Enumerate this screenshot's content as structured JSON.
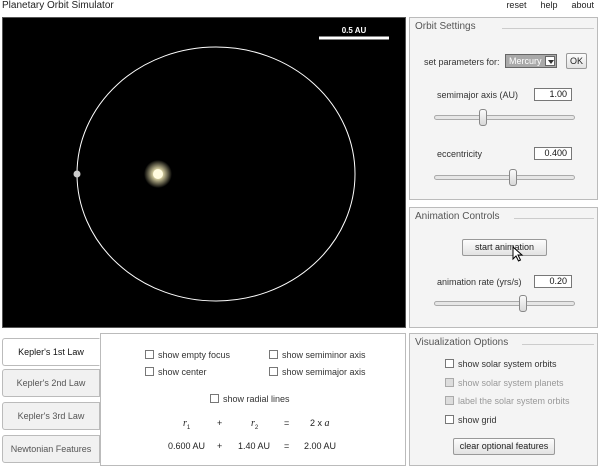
{
  "app": {
    "title": "Planetary Orbit Simulator"
  },
  "top_links": [
    "reset",
    "help",
    "about"
  ],
  "sim": {
    "scale_label": "0.5 AU"
  },
  "orbit_settings": {
    "title": "Orbit Settings",
    "set_params_label": "set parameters for:",
    "planet_selected": "Mercury",
    "ok_label": "OK",
    "semimajor_label": "semimajor axis (AU)",
    "semimajor_value": "1.00",
    "semimajor_slider": 0.35,
    "eccentricity_label": "eccentricity",
    "eccentricity_value": "0.400",
    "eccentricity_slider": 0.56
  },
  "animation": {
    "title": "Animation Controls",
    "start_label": "start animation",
    "rate_label": "animation rate (yrs/s)",
    "rate_value": "0.20",
    "rate_slider": 0.63
  },
  "visualization": {
    "title": "Visualization Options",
    "options": [
      {
        "label": "show solar system orbits",
        "enabled": true,
        "checked": false
      },
      {
        "label": "show solar system planets",
        "enabled": false,
        "checked": false
      },
      {
        "label": "label the solar system orbits",
        "enabled": false,
        "checked": false
      },
      {
        "label": "show grid",
        "enabled": true,
        "checked": false
      }
    ],
    "clear_label": "clear optional features"
  },
  "tabs": [
    "Kepler's 1st Law",
    "Kepler's 2nd Law",
    "Kepler's 3rd Law",
    "Newtonian Features"
  ],
  "kepler1": {
    "show_empty_focus": "show empty focus",
    "show_center": "show center",
    "show_semiminor": "show semiminor axis",
    "show_semimajor": "show semimajor axis",
    "show_radial": "show radial lines",
    "r1_value": "0.600 AU",
    "r2_value": "1.40 AU",
    "sum_value": "2.00 AU"
  },
  "colors": {
    "orbit": "#ffffff",
    "sun": "#fff6c0",
    "planet": "#cccccc",
    "sky": "#000000"
  }
}
